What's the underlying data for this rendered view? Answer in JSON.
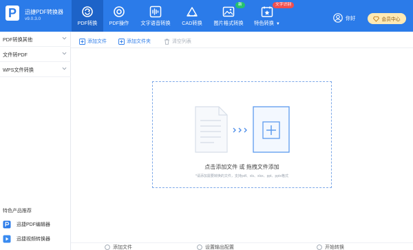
{
  "app": {
    "name": "迅捷PDF转换器",
    "version": "v9.0.3.0",
    "logo_letter": "P"
  },
  "nav": [
    {
      "label": "PDF转换",
      "icon": "sync-icon",
      "active": true
    },
    {
      "label": "PDF操作",
      "icon": "target-icon",
      "active": false
    },
    {
      "label": "文字语音转换",
      "icon": "waveform-icon",
      "active": false
    },
    {
      "label": "CAD转换",
      "icon": "drafting-icon",
      "active": false
    },
    {
      "label": "图片格式转换",
      "icon": "image-icon",
      "active": false,
      "badge": "新"
    },
    {
      "label": "特色转换",
      "icon": "calendar-star-icon",
      "active": false,
      "badge": "文字识别"
    }
  ],
  "user": {
    "label": "你好",
    "vip_label": "会员中心"
  },
  "sidebar": {
    "items": [
      {
        "label": "PDF转换其他"
      },
      {
        "label": "文件转PDF"
      },
      {
        "label": "WPS文件转换"
      }
    ],
    "products_title": "特色产品推荐",
    "products": [
      {
        "label": "迅捷PDF编辑器",
        "icon": "pdf-editor-icon"
      },
      {
        "label": "迅捷视频转换器",
        "icon": "video-converter-icon"
      }
    ]
  },
  "toolbar": {
    "add_file": "添加文件",
    "add_folder": "添加文件夹",
    "clear_list": "清空列表"
  },
  "dropzone": {
    "title": "点击添加文件 或 拖拽文件添加",
    "hint": "*请添加需要转换的文件，支持pdf、xls、xlsx、ppt、pptx格式"
  },
  "bottom": {
    "item1": "添加文件",
    "item2": "设置输出配置",
    "item3": "开始转换"
  },
  "colors": {
    "header": "#2B7BE9",
    "nav_active": "#1D63C8",
    "badge_green": "#25C26E",
    "badge_red": "#F04E4E",
    "vip_bg": "#FFE9B3"
  }
}
